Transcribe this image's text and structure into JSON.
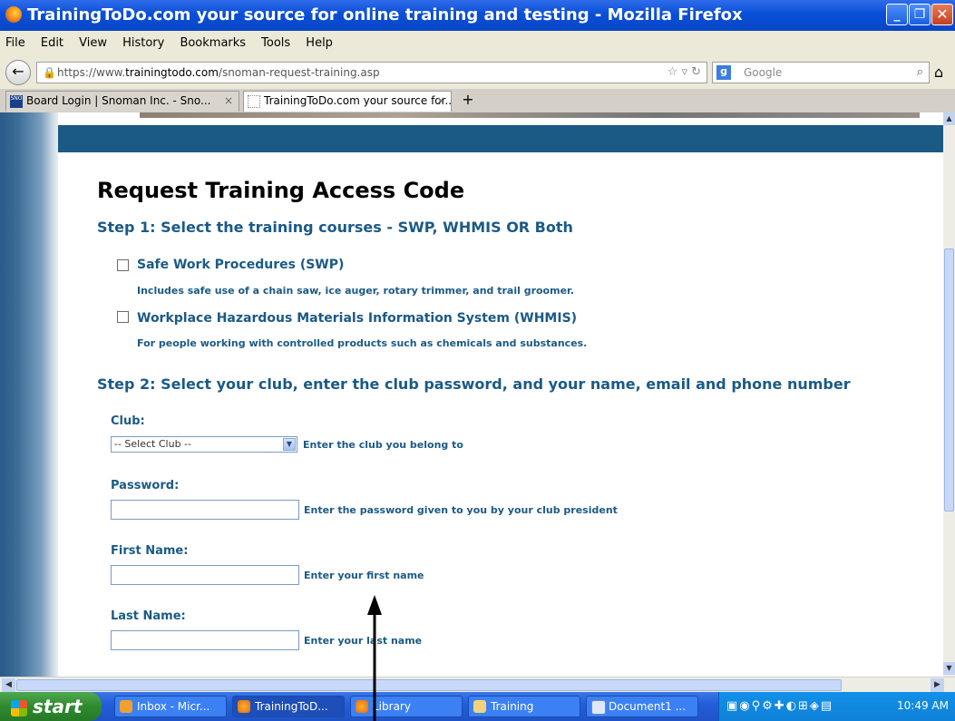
{
  "window": {
    "title": "TrainingToDo.com your source for online training and testing - Mozilla Firefox",
    "min": "_",
    "max": "❐",
    "close": "✕"
  },
  "menu": [
    "File",
    "Edit",
    "View",
    "History",
    "Bookmarks",
    "Tools",
    "Help"
  ],
  "nav": {
    "url_prefix": "https://www.",
    "url_domain": "trainingtodo.com",
    "url_path": "/snoman-request-training.asp",
    "search_placeholder": "Google"
  },
  "tabs": [
    {
      "label": "Board Login | Snoman Inc. - Sno...",
      "close": "×"
    },
    {
      "label": "TrainingToDo.com your source for...",
      "close": "×"
    }
  ],
  "newtab": "+",
  "page": {
    "heading": "Request Training Access Code",
    "step1": "Step 1: Select the training courses - SWP, WHMIS OR Both",
    "courses": [
      {
        "title": "Safe Work Procedures (SWP)",
        "desc": "Includes safe use of a chain saw, ice auger, rotary trimmer, and trail groomer.",
        "checked": false
      },
      {
        "title": "Workplace Hazardous Materials Information System (WHMIS)",
        "desc": "For people working with controlled products such as chemicals and substances.",
        "checked": false
      }
    ],
    "step2": "Step 2: Select your club, enter the club password, and your name, email and phone number",
    "club": {
      "label": "Club:",
      "selected": "-- Select Club --",
      "hint": "Enter the club you belong to"
    },
    "password": {
      "label": "Password:",
      "value": "",
      "hint": "Enter the password given to you by your club president"
    },
    "first_name": {
      "label": "First Name:",
      "value": "",
      "hint": "Enter your first name"
    },
    "last_name": {
      "label": "Last Name:",
      "value": "",
      "hint": "Enter your last name"
    }
  },
  "taskbar": {
    "start": "start",
    "tasks": [
      {
        "label": "Inbox - Micr..."
      },
      {
        "label": "TrainingToD..."
      },
      {
        "label": "Library"
      },
      {
        "label": "Training"
      },
      {
        "label": "Document1 ..."
      }
    ],
    "clock": "10:49 AM"
  },
  "colors": {
    "heading_blue": "#1b5a86",
    "banner": "#1a5a85",
    "titlebar": "#0a4fd8",
    "taskbar": "#245edb"
  }
}
